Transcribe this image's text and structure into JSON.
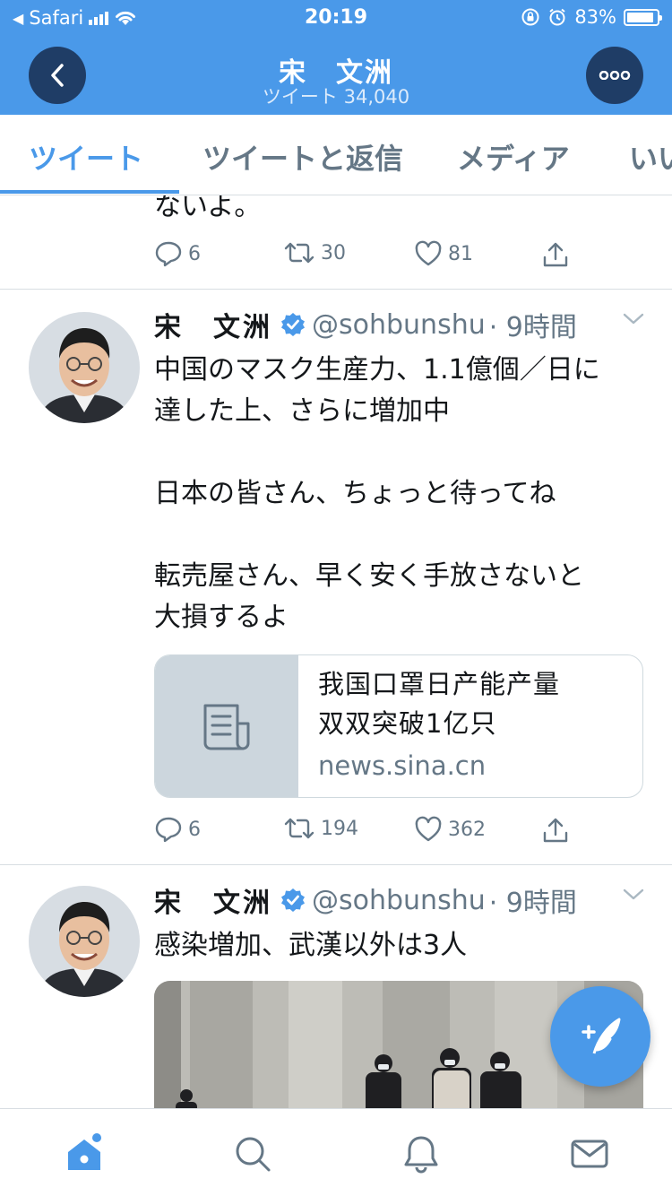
{
  "status_bar": {
    "back_app": "Safari",
    "time": "20:19",
    "battery": "83%"
  },
  "header": {
    "title": "宋　文洲",
    "subtitle": "ツイート 34,040",
    "back_icon": "chevron-left-icon",
    "more_icon": "more-horizontal-icon"
  },
  "tabs": [
    {
      "label": "ツイート",
      "active": true
    },
    {
      "label": "ツイートと返信",
      "active": false
    },
    {
      "label": "メディア",
      "active": false
    },
    {
      "label": "いい",
      "active": false
    }
  ],
  "tweets": [
    {
      "text_tail": "ないよ。",
      "replies": "6",
      "retweets": "30",
      "likes": "81"
    },
    {
      "name": "宋　文洲",
      "handle": "@sohbunshu",
      "time": "· 9時間",
      "text": "中国のマスク生産力、1.1億個／日に\n達した上、さらに増加中\n\n日本の皆さん、ちょっと待ってね\n\n転売屋さん、早く安く手放さないと\n大損するよ",
      "card": {
        "title": "我国口罩日产能产量\n双双突破1亿只",
        "domain": "news.sina.cn"
      },
      "replies": "6",
      "retweets": "194",
      "likes": "362"
    },
    {
      "name": "宋　文洲",
      "handle": "@sohbunshu",
      "time": "· 9時間",
      "text": "感染増加、武漢以外は3人"
    }
  ],
  "fab_icon": "compose-tweet-icon",
  "bottom_nav": [
    "home-icon",
    "search-icon",
    "notifications-icon",
    "messages-icon"
  ],
  "colors": {
    "accent": "#4a99e9",
    "header_button": "#1f3d66",
    "muted": "#657786"
  }
}
